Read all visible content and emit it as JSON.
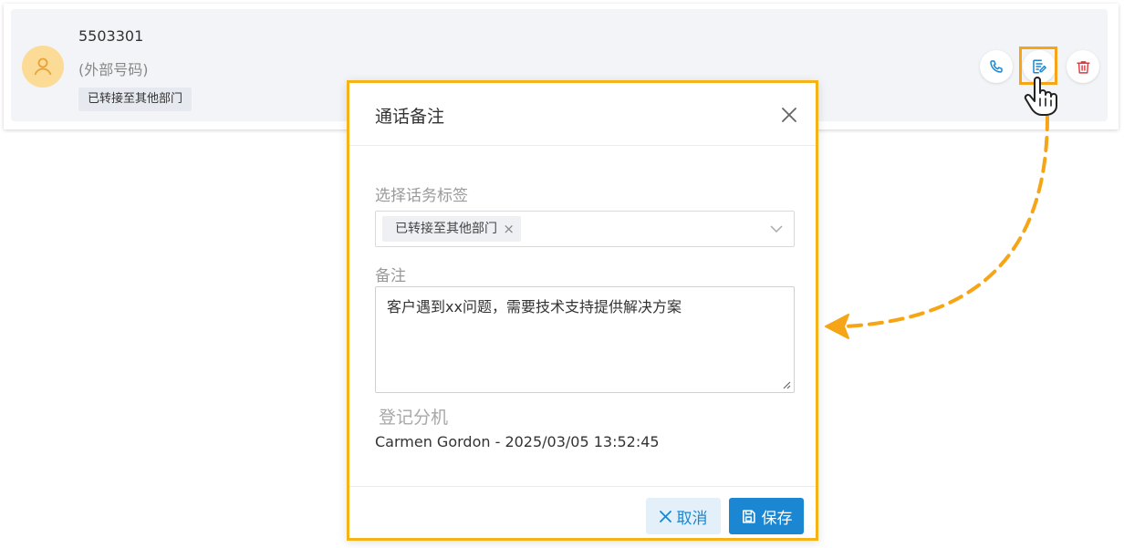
{
  "record": {
    "number": "5503301",
    "number_type": "(外部号码)",
    "tag": "已转接至其他部门"
  },
  "icons": {
    "avatar": "user-icon",
    "call": "phone-icon",
    "note": "note-edit-icon",
    "delete": "trash-icon",
    "cursor": "hand-pointer-icon"
  },
  "colors": {
    "highlight": "#f5a515",
    "accent": "#1b86d1",
    "delete": "#e0383e",
    "avatar_bg": "#fbdb96"
  },
  "modal": {
    "title": "通话备注",
    "tags_label": "选择话务标签",
    "selected_tag": "已转接至其他部门",
    "note_label": "备注",
    "note_value": "客户遇到xx问题，需要技术支持提供解决方案",
    "registrar_label": "登记分机",
    "registrar_value": "Carmen Gordon - 2025/03/05 13:52:45",
    "cancel_label": "取消",
    "save_label": "保存"
  }
}
